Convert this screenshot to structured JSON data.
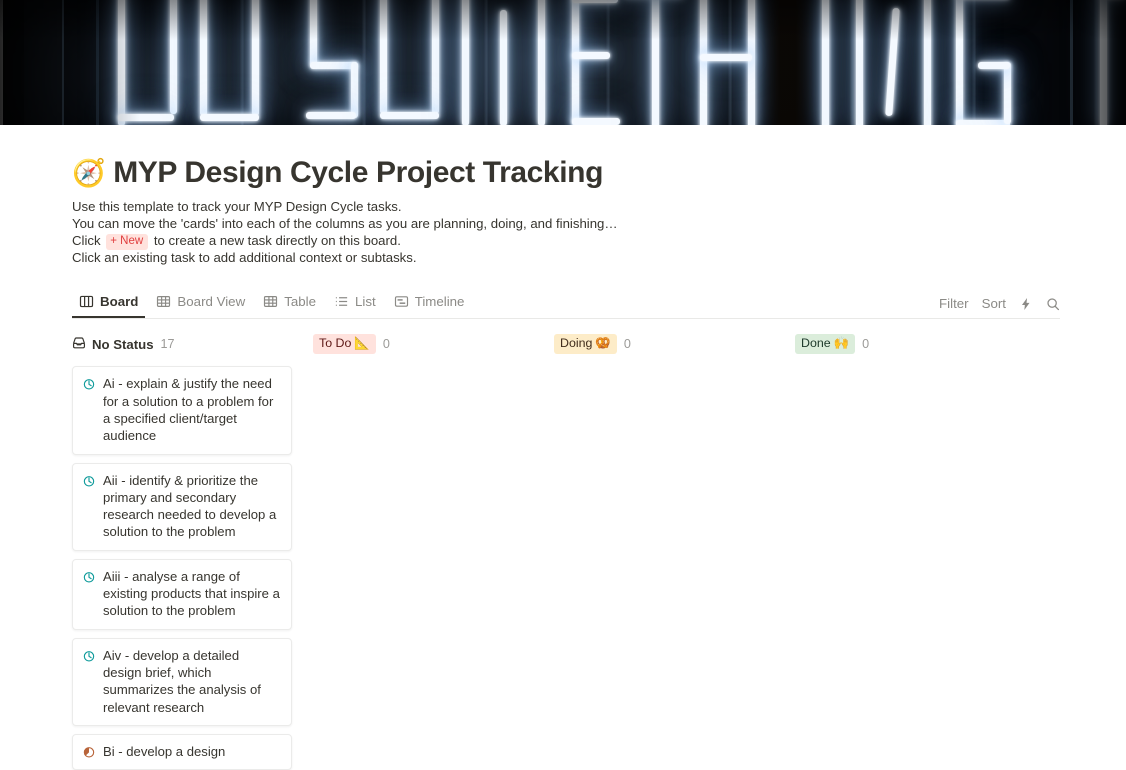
{
  "cover": {
    "alt_text": "DO SOMETHING GREAT neon sign",
    "neon_text": "DO SOMETHING GREAT"
  },
  "page": {
    "emoji": "🧭",
    "title": "MYP Design Cycle Project Tracking",
    "description": {
      "line1": "Use this template to track your MYP Design Cycle tasks.",
      "line2": "You can move the 'cards' into each of the columns as you are planning, doing, and finishing…",
      "line3_prefix": "Click",
      "line3_chip": "+ New",
      "line3_suffix": "to create a new task directly on this board.",
      "line4": "Click an existing task to add additional context or subtasks."
    }
  },
  "viewbar": {
    "tabs": [
      {
        "label": "Board",
        "icon": "board-icon",
        "active": true
      },
      {
        "label": "Board View",
        "icon": "grid-icon",
        "active": false
      },
      {
        "label": "Table",
        "icon": "table-icon",
        "active": false
      },
      {
        "label": "List",
        "icon": "list-icon",
        "active": false
      },
      {
        "label": "Timeline",
        "icon": "timeline-icon",
        "active": false
      }
    ],
    "actions": {
      "filter": "Filter",
      "sort": "Sort",
      "automation_icon": "lightning-icon",
      "search_icon": "search-icon"
    }
  },
  "board": {
    "columns": [
      {
        "id": "no-status",
        "label": "No Status",
        "icon": "inbox-tray-icon",
        "style": "plain",
        "count": "17",
        "cards": [
          {
            "icon": "clock-progress-icon",
            "icon_color": "#0f9b9b",
            "title": "Ai - explain & justify the need for a solution to a problem for a specified client/target audience"
          },
          {
            "icon": "clock-progress-icon",
            "icon_color": "#0f9b9b",
            "title": "Aii - identify & prioritize the primary and secondary research needed to develop a solution to the problem"
          },
          {
            "icon": "clock-progress-icon",
            "icon_color": "#0f9b9b",
            "title": "Aiii - analyse a range of existing products that inspire a solution to the problem"
          },
          {
            "icon": "clock-progress-icon",
            "icon_color": "#0f9b9b",
            "title": "Aiv - develop a detailed design brief, which summarizes the analysis of relevant research"
          },
          {
            "icon": "pie-half-icon",
            "icon_color": "#b8643a",
            "title": "Bi - develop a design"
          }
        ]
      },
      {
        "id": "to-do",
        "label": "To Do",
        "emoji": "📐",
        "style": "chip-todo",
        "count": "0",
        "cards": []
      },
      {
        "id": "doing",
        "label": "Doing",
        "emoji": "🥨",
        "style": "chip-doing",
        "count": "0",
        "cards": []
      },
      {
        "id": "done",
        "label": "Done",
        "emoji": "🙌",
        "style": "chip-done",
        "count": "0",
        "cards": []
      }
    ]
  },
  "colors": {
    "accent_red": "#e03e3e",
    "chip_todo_bg": "#ffe2dd",
    "chip_doing_bg": "#fdecc8",
    "chip_done_bg": "#dbeddb",
    "text_primary": "#37352f",
    "text_muted": "#9b9a97",
    "card_icon_teal": "#0f9b9b",
    "card_icon_orange": "#b8643a"
  }
}
